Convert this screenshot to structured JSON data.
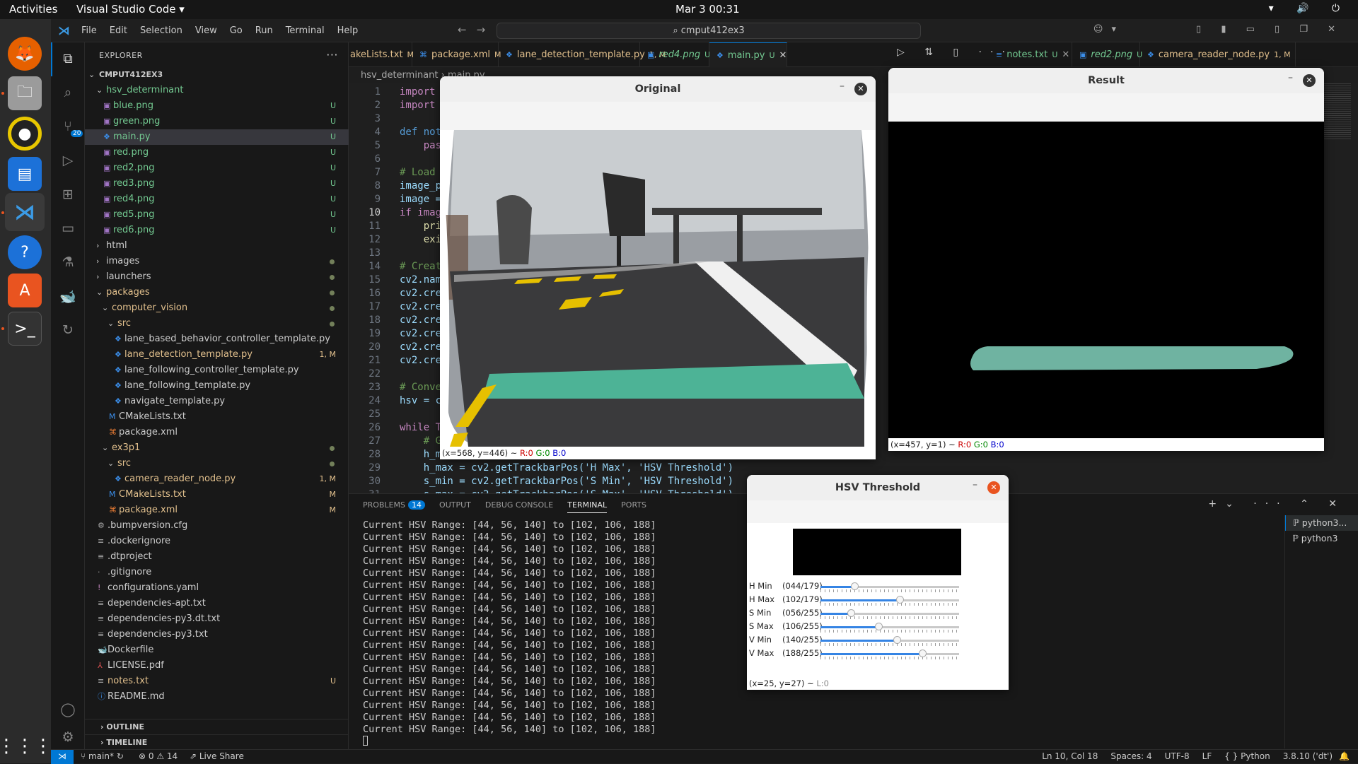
{
  "topbar": {
    "activities": "Activities",
    "app": "Visual Studio Code ▾",
    "clock": "Mar 3  00:31",
    "sys": "▾ 🔊 ⏻"
  },
  "titlebar": {
    "menu": [
      "File",
      "Edit",
      "Selection",
      "View",
      "Go",
      "Run",
      "Terminal",
      "Help"
    ],
    "search": "cmput412ex3"
  },
  "sidebar": {
    "title": "EXPLORER",
    "root": "CMPUT412EX3"
  },
  "tree": [
    {
      "name": "hsv_determinant",
      "depth": 1,
      "type": "folder-open",
      "color": "#73c991"
    },
    {
      "name": "blue.png",
      "depth": 2,
      "type": "img",
      "badge": "U",
      "color": "#73c991"
    },
    {
      "name": "green.png",
      "depth": 2,
      "type": "img",
      "badge": "U",
      "color": "#73c991"
    },
    {
      "name": "main.py",
      "depth": 2,
      "type": "py",
      "badge": "U",
      "color": "#73c991",
      "sel": true
    },
    {
      "name": "red.png",
      "depth": 2,
      "type": "img",
      "badge": "U",
      "color": "#73c991"
    },
    {
      "name": "red2.png",
      "depth": 2,
      "type": "img",
      "badge": "U",
      "color": "#73c991"
    },
    {
      "name": "red3.png",
      "depth": 2,
      "type": "img",
      "badge": "U",
      "color": "#73c991"
    },
    {
      "name": "red4.png",
      "depth": 2,
      "type": "img",
      "badge": "U",
      "color": "#73c991"
    },
    {
      "name": "red5.png",
      "depth": 2,
      "type": "img",
      "badge": "U",
      "color": "#73c991"
    },
    {
      "name": "red6.png",
      "depth": 2,
      "type": "img",
      "badge": "U",
      "color": "#73c991"
    },
    {
      "name": "html",
      "depth": 1,
      "type": "folder",
      "color": "#cccccc"
    },
    {
      "name": "images",
      "depth": 1,
      "type": "folder",
      "color": "#cccccc",
      "dot": true
    },
    {
      "name": "launchers",
      "depth": 1,
      "type": "folder",
      "color": "#cccccc",
      "dot": true
    },
    {
      "name": "packages",
      "depth": 1,
      "type": "folder-open",
      "color": "#e2c08d",
      "dot": true
    },
    {
      "name": "computer_vision",
      "depth": 2,
      "type": "folder-open",
      "color": "#e2c08d",
      "dot": true
    },
    {
      "name": "src",
      "depth": 3,
      "type": "folder-open",
      "color": "#e2c08d",
      "dot": true
    },
    {
      "name": "lane_based_behavior_controller_template.py",
      "depth": 4,
      "type": "py",
      "color": "#cccccc"
    },
    {
      "name": "lane_detection_template.py",
      "depth": 4,
      "type": "py",
      "color": "#e2c08d",
      "badge": "1, M"
    },
    {
      "name": "lane_following_controller_template.py",
      "depth": 4,
      "type": "py",
      "color": "#cccccc"
    },
    {
      "name": "lane_following_template.py",
      "depth": 4,
      "type": "py",
      "color": "#cccccc"
    },
    {
      "name": "navigate_template.py",
      "depth": 4,
      "type": "py",
      "color": "#cccccc"
    },
    {
      "name": "CMakeLists.txt",
      "depth": 3,
      "type": "cmake",
      "color": "#cccccc"
    },
    {
      "name": "package.xml",
      "depth": 3,
      "type": "xml",
      "color": "#cccccc"
    },
    {
      "name": "ex3p1",
      "depth": 2,
      "type": "folder-open",
      "color": "#e2c08d",
      "dot": true
    },
    {
      "name": "src",
      "depth": 3,
      "type": "folder-open",
      "color": "#e2c08d",
      "dot": true
    },
    {
      "name": "camera_reader_node.py",
      "depth": 4,
      "type": "py",
      "color": "#e2c08d",
      "badge": "1, M"
    },
    {
      "name": "CMakeLists.txt",
      "depth": 3,
      "type": "cmake",
      "color": "#e2c08d",
      "badge": "M"
    },
    {
      "name": "package.xml",
      "depth": 3,
      "type": "xml",
      "color": "#e2c08d",
      "badge": "M"
    },
    {
      "name": ".bumpversion.cfg",
      "depth": 1,
      "type": "gear",
      "color": "#cccccc"
    },
    {
      "name": ".dockerignore",
      "depth": 1,
      "type": "lines",
      "color": "#cccccc"
    },
    {
      "name": ".dtproject",
      "depth": 1,
      "type": "lines",
      "color": "#cccccc"
    },
    {
      "name": ".gitignore",
      "depth": 1,
      "type": "git",
      "color": "#cccccc"
    },
    {
      "name": "configurations.yaml",
      "depth": 1,
      "type": "yaml",
      "color": "#cccccc"
    },
    {
      "name": "dependencies-apt.txt",
      "depth": 1,
      "type": "lines",
      "color": "#cccccc"
    },
    {
      "name": "dependencies-py3.dt.txt",
      "depth": 1,
      "type": "lines",
      "color": "#cccccc"
    },
    {
      "name": "dependencies-py3.txt",
      "depth": 1,
      "type": "lines",
      "color": "#cccccc"
    },
    {
      "name": "Dockerfile",
      "depth": 1,
      "type": "docker",
      "color": "#cccccc"
    },
    {
      "name": "LICENSE.pdf",
      "depth": 1,
      "type": "pdf",
      "color": "#cccccc"
    },
    {
      "name": "notes.txt",
      "depth": 1,
      "type": "lines",
      "color": "#e2c08d",
      "badge": "U"
    },
    {
      "name": "README.md",
      "depth": 1,
      "type": "info",
      "color": "#cccccc"
    }
  ],
  "outline": "OUTLINE",
  "timeline": "TIMELINE",
  "tabs_left": [
    {
      "label": "akeLists.txt",
      "badge": "M",
      "color": "#e2c08d"
    },
    {
      "label": "package.xml",
      "badge": "M",
      "color": "#e2c08d"
    },
    {
      "label": "lane_detection_template.py",
      "badge": "1, M",
      "color": "#e2c08d"
    },
    {
      "label": "red4.png",
      "badge": "U",
      "color": "#73c991"
    },
    {
      "label": "main.py",
      "badge": "U",
      "color": "#73c991"
    }
  ],
  "tabs_right": [
    {
      "label": "notes.txt",
      "badge": "U",
      "color": "#73c991"
    },
    {
      "label": "red2.png",
      "badge": "U",
      "color": "#73c991"
    },
    {
      "label": "camera_reader_node.py",
      "badge": "1, M",
      "color": "#e2c08d"
    }
  ],
  "breadcrumb": "hsv_determinant  ›  main.py",
  "code": [
    {
      "n": "1",
      "t": "import",
      "c": "kw"
    },
    {
      "n": "2",
      "t": "import",
      "c": "kw"
    },
    {
      "n": "3",
      "t": "",
      "c": "pl"
    },
    {
      "n": "4",
      "t": "def not",
      "c": "bl"
    },
    {
      "n": "5",
      "t": "    pas",
      "c": "kw"
    },
    {
      "n": "6",
      "t": "",
      "c": "pl"
    },
    {
      "n": "7",
      "t": "# Load",
      "c": "cm"
    },
    {
      "n": "8",
      "t": "image_p",
      "c": "var"
    },
    {
      "n": "9",
      "t": "image =",
      "c": "var"
    },
    {
      "n": "10",
      "t": "if imag",
      "c": "kw"
    },
    {
      "n": "11",
      "t": "    pri",
      "c": "fn"
    },
    {
      "n": "12",
      "t": "    exi",
      "c": "fn"
    },
    {
      "n": "13",
      "t": "",
      "c": "pl"
    },
    {
      "n": "14",
      "t": "# Creat",
      "c": "cm"
    },
    {
      "n": "15",
      "t": "cv2.nam",
      "c": "var"
    },
    {
      "n": "16",
      "t": "cv2.cre",
      "c": "var"
    },
    {
      "n": "17",
      "t": "cv2.cre",
      "c": "var"
    },
    {
      "n": "18",
      "t": "cv2.cre",
      "c": "var"
    },
    {
      "n": "19",
      "t": "cv2.cre",
      "c": "var"
    },
    {
      "n": "20",
      "t": "cv2.cre",
      "c": "var"
    },
    {
      "n": "21",
      "t": "cv2.cre",
      "c": "var"
    },
    {
      "n": "22",
      "t": "",
      "c": "pl"
    },
    {
      "n": "23",
      "t": "# Conve",
      "c": "cm"
    },
    {
      "n": "24",
      "t": "hsv = c",
      "c": "var"
    },
    {
      "n": "25",
      "t": "",
      "c": "pl"
    },
    {
      "n": "26",
      "t": "while T",
      "c": "kw"
    },
    {
      "n": "27",
      "t": "    # G",
      "c": "cm"
    },
    {
      "n": "28",
      "t": "    h_m",
      "c": "var"
    },
    {
      "n": "29",
      "t": "    h_max = cv2.getTrackbarPos('H Max', 'HSV Threshold')",
      "c": "var"
    },
    {
      "n": "30",
      "t": "    s_min = cv2.getTrackbarPos('S Min', 'HSV Threshold')",
      "c": "var"
    },
    {
      "n": "31",
      "t": "    s_max = cv2.getTrackbarPos('S Max', 'HSV Threshold')",
      "c": "var"
    }
  ],
  "panel": {
    "tabs": [
      "PROBLEMS",
      "OUTPUT",
      "DEBUG CONSOLE",
      "TERMINAL",
      "PORTS"
    ],
    "problems_count": "14",
    "active": "TERMINAL",
    "line": "Current HSV Range: [44, 56, 140] to [102, 106, 188]",
    "line_count": 18,
    "terminals": [
      "python3...",
      "python3"
    ]
  },
  "status": {
    "branch": "main*",
    "errors": "⊗ 0 ⚠ 14",
    "liveshare": "Live Share",
    "right": [
      "Ln 10, Col 18",
      "Spaces: 4",
      "UTF-8",
      "LF",
      "{ } Python",
      "3.8.10 ('dt')"
    ]
  },
  "win_original": {
    "title": "Original",
    "footer": "(x=568, y=446) ~ ",
    "r": "R:0",
    "g": "G:0",
    "b": "B:0"
  },
  "win_result": {
    "title": "Result",
    "footer": "(x=457, y=1) ~ ",
    "r": "R:0",
    "g": "G:0",
    "b": "B:0"
  },
  "win_hsv": {
    "title": "HSV Threshold",
    "footer": "(x=25, y=27) ~ ",
    "l": "L:0",
    "sliders": [
      {
        "label": "H Min",
        "value": "(044/179)",
        "frac": 0.246
      },
      {
        "label": "H Max",
        "value": "(102/179)",
        "frac": 0.57
      },
      {
        "label": "S Min",
        "value": "(056/255)",
        "frac": 0.22
      },
      {
        "label": "S Max",
        "value": "(106/255)",
        "frac": 0.416
      },
      {
        "label": "V Min",
        "value": "(140/255)",
        "frac": 0.549
      },
      {
        "label": "V Max",
        "value": "(188/255)",
        "frac": 0.737
      }
    ]
  }
}
